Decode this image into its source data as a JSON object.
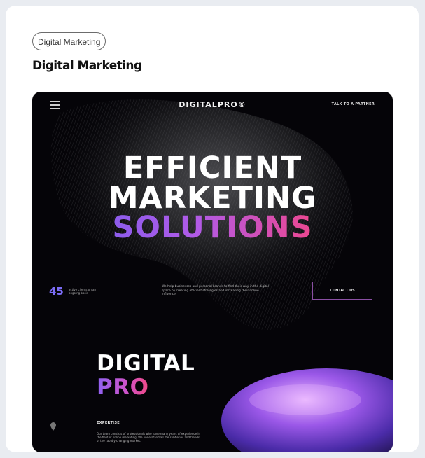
{
  "card": {
    "tag_label": "Digital Marketing",
    "title": "Digital Marketing"
  },
  "preview": {
    "nav": {
      "menu_icon": "hamburger-icon",
      "logo": "DIGITALPRO®",
      "cta": "TALK TO A PARTNER"
    },
    "hero": {
      "line1": "EFFICIENT",
      "line2": "MARKETING",
      "line3": "SOLUTIONS"
    },
    "stat": {
      "number": "45",
      "label": "active clients on an ongoing basis"
    },
    "description": "We help businesses and personal brands to find their way in the digital space by creating efficient strategies and increasing their online influence.",
    "contact_button": "CONTACT US",
    "section": {
      "line1": "DIGITAL",
      "line2": "PRO",
      "expertise_label": "EXPERTISE",
      "expertise_text": "Our team consists of professionals who have many years of experience in the field of online marketing. We understand all the subtleties and trends of the rapidly changing market."
    },
    "colors": {
      "background": "#050408",
      "accent_purple": "#7b6cf6",
      "accent_pink": "#f0468a"
    }
  }
}
